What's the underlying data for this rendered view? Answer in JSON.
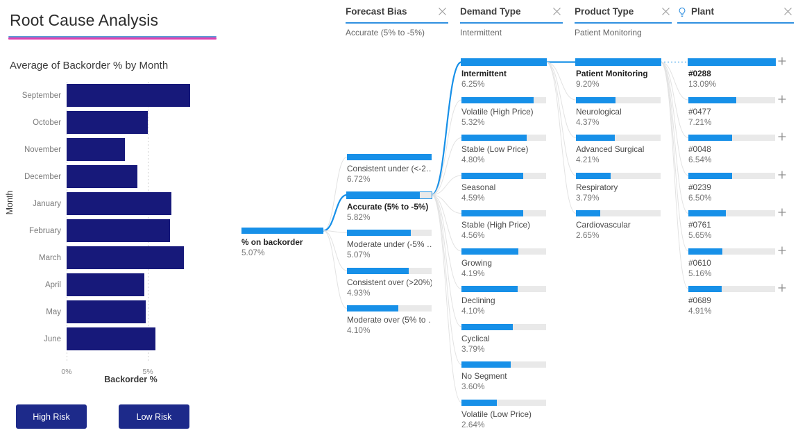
{
  "page": {
    "title": "Root Cause Analysis"
  },
  "bar_chart": {
    "title": "Average of Backorder % by Month",
    "y_axis_title": "Month",
    "x_axis_title": "Backorder %"
  },
  "chart_data": {
    "type": "bar",
    "title": "Average of Backorder % by Month",
    "xlabel": "Backorder %",
    "ylabel": "Month",
    "orientation": "horizontal",
    "xlim": [
      0,
      7.9
    ],
    "xticks": [
      "0%",
      "5%"
    ],
    "xtick_values": [
      0,
      5
    ],
    "grid": true,
    "bar_color": "#17197a",
    "categories": [
      "September",
      "October",
      "November",
      "December",
      "January",
      "February",
      "March",
      "April",
      "May",
      "June"
    ],
    "values": [
      7.6,
      5.0,
      3.6,
      4.35,
      6.45,
      6.35,
      7.2,
      4.8,
      4.85,
      5.45
    ]
  },
  "buttons": {
    "high_risk": "High Risk",
    "low_risk": "Low Risk"
  },
  "filters": [
    {
      "name": "Forecast Bias",
      "value": "Accurate (5% to -5%)",
      "icon": "",
      "close_icon": "close-icon"
    },
    {
      "name": "Demand Type",
      "value": "Intermittent",
      "icon": "",
      "close_icon": "close-icon"
    },
    {
      "name": "Product Type",
      "value": "Patient Monitoring",
      "icon": "",
      "close_icon": "close-icon"
    },
    {
      "name": "Plant",
      "value": "",
      "icon": "lightbulb-icon",
      "close_icon": "close-icon"
    }
  ],
  "tree": {
    "root": {
      "label": "% on backorder",
      "value": "5.07%"
    },
    "columns": [
      {
        "field": "Forecast Bias",
        "nodes": [
          {
            "label": "Consistent under (<-2…",
            "value": "6.72%",
            "pct": 100,
            "selected": false
          },
          {
            "label": "Accurate (5% to -5%)",
            "value": "5.82%",
            "pct": 86,
            "selected": true
          },
          {
            "label": "Moderate under (-5% …",
            "value": "5.07%",
            "pct": 75,
            "selected": false
          },
          {
            "label": "Consistent over (>20%)",
            "value": "4.93%",
            "pct": 73,
            "selected": false
          },
          {
            "label": "Moderate over (5% to …",
            "value": "4.10%",
            "pct": 61,
            "selected": false
          }
        ]
      },
      {
        "field": "Demand Type",
        "nodes": [
          {
            "label": "Intermittent",
            "value": "6.25%",
            "pct": 100,
            "selected": true
          },
          {
            "label": "Volatile (High Price)",
            "value": "5.32%",
            "pct": 85,
            "selected": false
          },
          {
            "label": "Stable (Low Price)",
            "value": "4.80%",
            "pct": 77,
            "selected": false
          },
          {
            "label": "Seasonal",
            "value": "4.59%",
            "pct": 73,
            "selected": false
          },
          {
            "label": "Stable (High Price)",
            "value": "4.56%",
            "pct": 73,
            "selected": false
          },
          {
            "label": "Growing",
            "value": "4.19%",
            "pct": 67,
            "selected": false
          },
          {
            "label": "Declining",
            "value": "4.10%",
            "pct": 66,
            "selected": false
          },
          {
            "label": "Cyclical",
            "value": "3.79%",
            "pct": 61,
            "selected": false
          },
          {
            "label": "No Segment",
            "value": "3.60%",
            "pct": 58,
            "selected": false
          },
          {
            "label": "Volatile (Low Price)",
            "value": "2.64%",
            "pct": 42,
            "selected": false
          }
        ]
      },
      {
        "field": "Product Type",
        "nodes": [
          {
            "label": "Patient Monitoring",
            "value": "9.20%",
            "pct": 100,
            "selected": true
          },
          {
            "label": "Neurological",
            "value": "4.37%",
            "pct": 47,
            "selected": false
          },
          {
            "label": "Advanced Surgical",
            "value": "4.21%",
            "pct": 46,
            "selected": false
          },
          {
            "label": "Respiratory",
            "value": "3.79%",
            "pct": 41,
            "selected": false
          },
          {
            "label": "Cardiovascular",
            "value": "2.65%",
            "pct": 29,
            "selected": false
          }
        ]
      },
      {
        "field": "Plant",
        "nodes": [
          {
            "label": "#0288",
            "value": "13.09%",
            "pct": 100,
            "selected": true,
            "expand": "plus-icon"
          },
          {
            "label": "#0477",
            "value": "7.21%",
            "pct": 55,
            "selected": false,
            "expand": "plus-icon"
          },
          {
            "label": "#0048",
            "value": "6.54%",
            "pct": 50,
            "selected": false,
            "expand": "plus-icon"
          },
          {
            "label": "#0239",
            "value": "6.50%",
            "pct": 50,
            "selected": false,
            "expand": "plus-icon"
          },
          {
            "label": "#0761",
            "value": "5.65%",
            "pct": 43,
            "selected": false,
            "expand": "plus-icon"
          },
          {
            "label": "#0610",
            "value": "5.16%",
            "pct": 39,
            "selected": false,
            "expand": "plus-icon"
          },
          {
            "label": "#0689",
            "value": "4.91%",
            "pct": 38,
            "selected": false,
            "expand": "plus-icon"
          }
        ]
      }
    ]
  },
  "colors": {
    "accent_blue": "#1790e8",
    "bar_navy": "#17197a",
    "button_navy": "#1d2a8a",
    "track_grey": "#e9e9e9",
    "rule_blue": "#5b9bd5",
    "rule_pink": "#e040b0"
  }
}
